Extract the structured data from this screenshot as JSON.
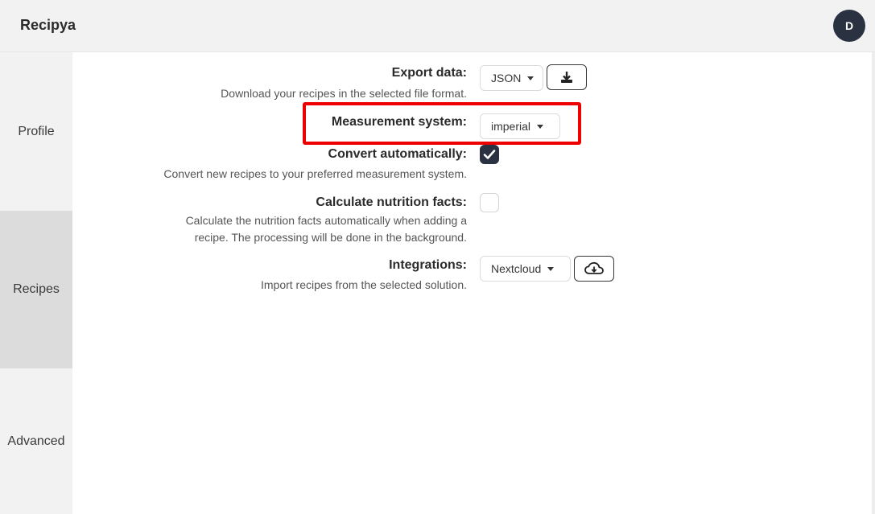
{
  "header": {
    "brand": "Recipya",
    "avatar_initial": "D"
  },
  "sidebar": {
    "items": [
      {
        "label": "Profile"
      },
      {
        "label": "Recipes"
      },
      {
        "label": "Advanced"
      }
    ]
  },
  "settings": {
    "export": {
      "label": "Export data:",
      "description": "Download your recipes in the selected file format.",
      "selected": "JSON"
    },
    "measurement": {
      "label": "Measurement system:",
      "selected": "imperial"
    },
    "convert": {
      "label": "Convert automatically:",
      "description": "Convert new recipes to your preferred measurement system.",
      "checked": true
    },
    "nutrition": {
      "label": "Calculate nutrition facts:",
      "description_line1": "Calculate the nutrition facts automatically when adding a",
      "description_line2": "recipe. The processing will be done in the background.",
      "checked": false
    },
    "integrations": {
      "label": "Integrations:",
      "description": "Import recipes from the selected solution.",
      "selected": "Nextcloud"
    }
  },
  "colors": {
    "accent": "#2a3140",
    "highlight": "#ee0000",
    "sidebar_active": "#dcdcdc"
  }
}
